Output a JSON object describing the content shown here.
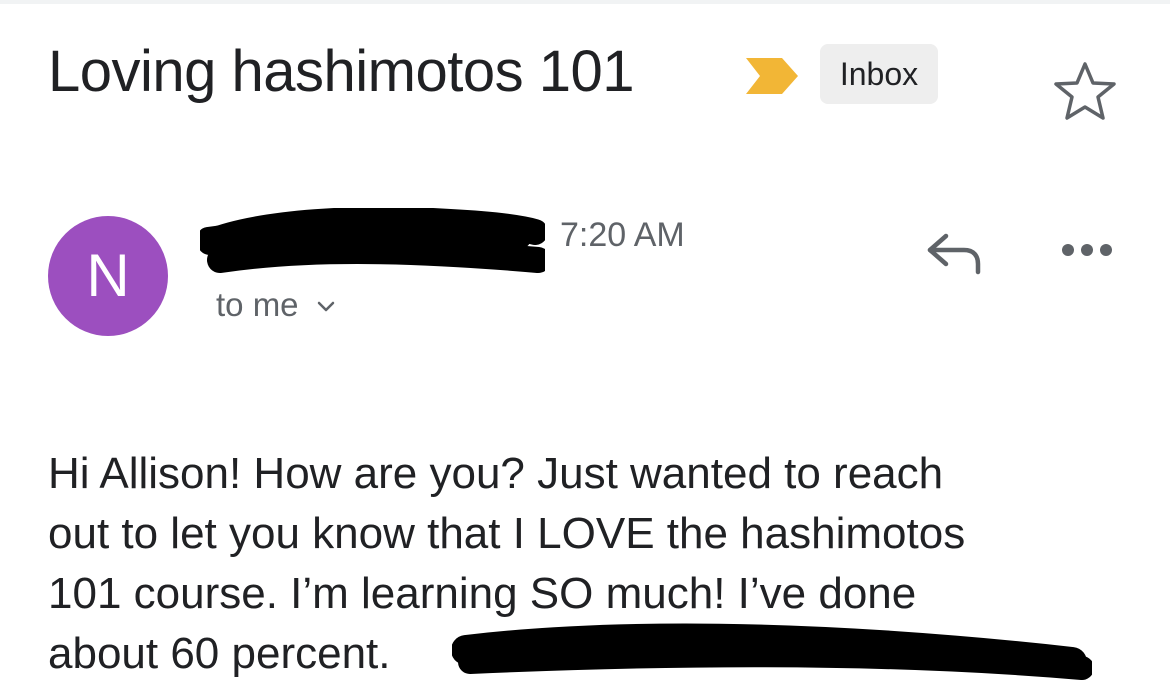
{
  "email": {
    "subject": "Loving hashimotos 101",
    "label": "Inbox",
    "sender": {
      "avatar_letter": "N",
      "avatar_color": "#9c4fbf",
      "time": "7:20 AM",
      "recipient": "to me"
    },
    "body_lines": [
      "Hi Allison! How are you? Just wanted to reach",
      "out to let you know that I LOVE the hashimotos",
      "101 course. I’m learning SO much! I’ve done",
      "about 60 percent."
    ]
  },
  "colors": {
    "importance_marker": "#f2b636",
    "label_chip_bg": "#eeeeee",
    "secondary_text": "#5f6368",
    "primary_text": "#202124"
  },
  "icons": {
    "importance": "importance-marker-icon",
    "star": "star-icon",
    "reply": "reply-icon",
    "more": "more-options-icon",
    "chevron": "chevron-down-icon"
  }
}
